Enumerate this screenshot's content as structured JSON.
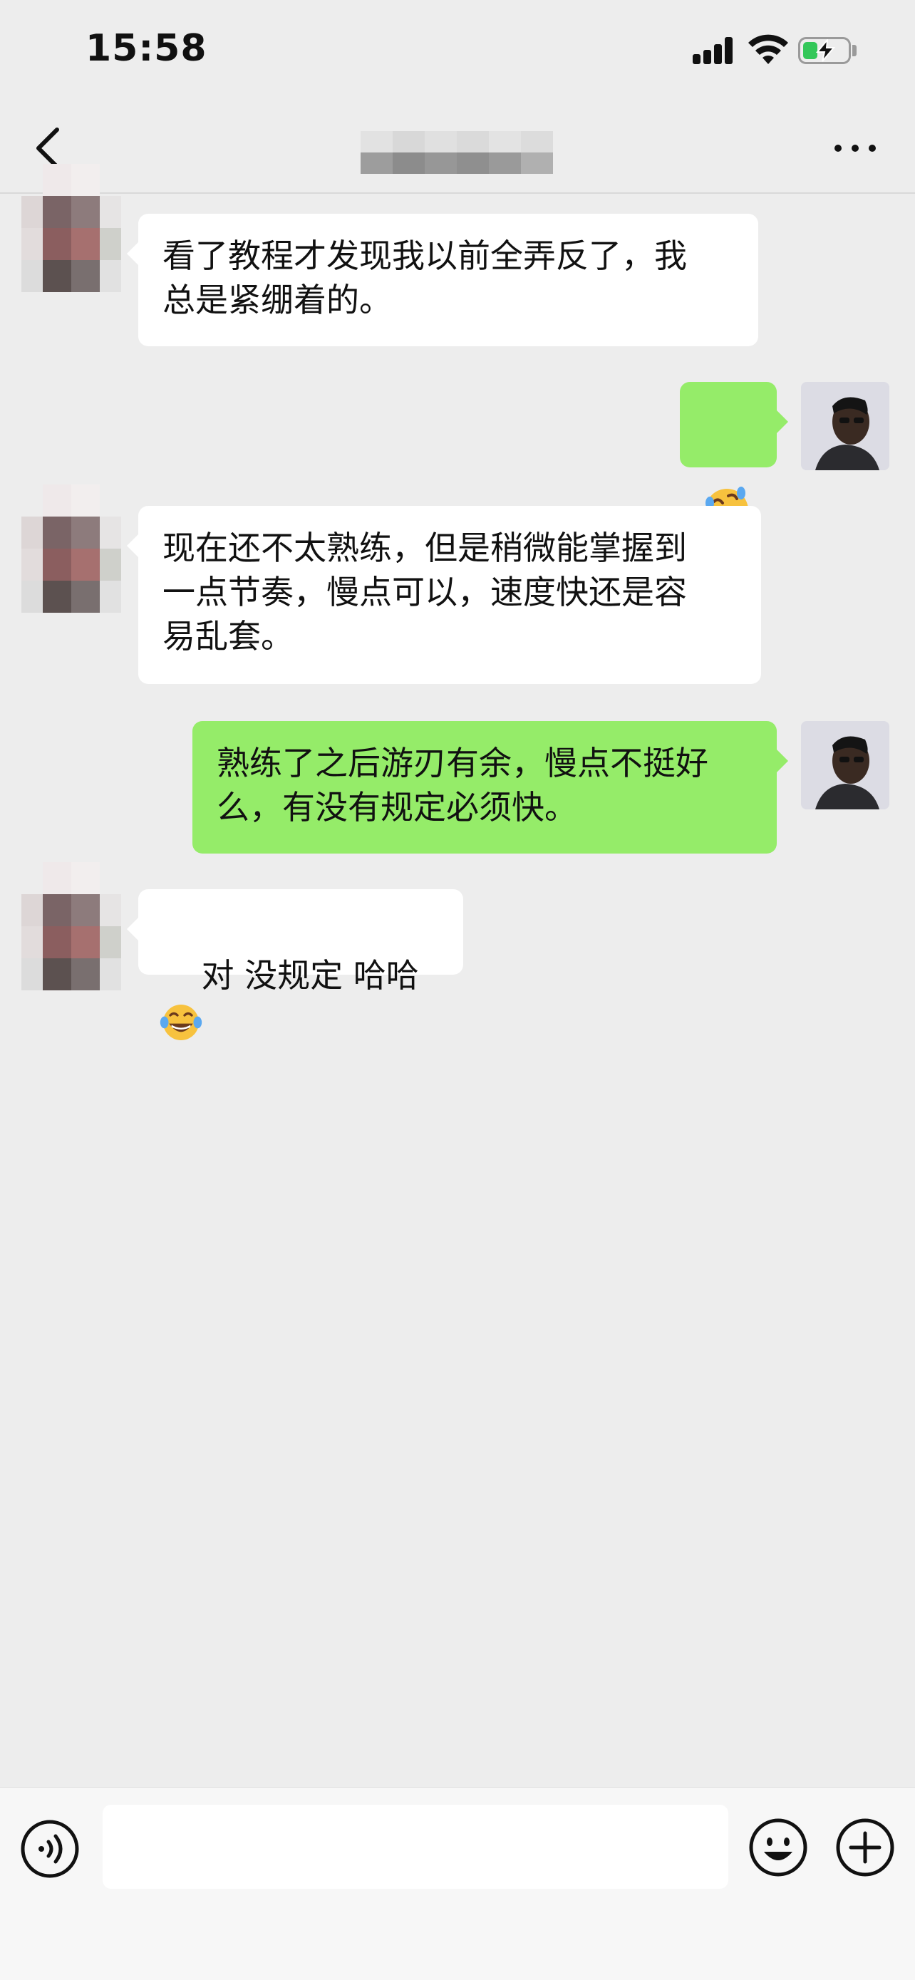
{
  "status_bar": {
    "time": "15:58",
    "battery_color": "#33c759"
  },
  "nav": {
    "back_icon": "chevron-left-icon",
    "more_icon": "ellipsis-icon"
  },
  "messages": [
    {
      "from": "contact",
      "text": "看了教程才发现我以前全弄反了，我\n总是紧绷着的。"
    },
    {
      "from": "me",
      "text": "",
      "emoji": "face-with-tears-of-joy-rolling"
    },
    {
      "from": "contact",
      "text": "现在还不太熟练，但是稍微能掌握到\n一点节奏，慢点可以，速度快还是容\n易乱套。"
    },
    {
      "from": "me",
      "text": "熟练了之后游刃有余，慢点不挺好\n么，有没有规定必须快。"
    },
    {
      "from": "contact",
      "text": "对 没规定 哈哈",
      "emoji": "face-with-tears-of-joy"
    }
  ],
  "input_bar": {
    "voice_icon": "voice-icon",
    "emoji_icon": "smiley-icon",
    "plus_icon": "plus-circle-icon",
    "message_value": "",
    "message_placeholder": ""
  },
  "colors": {
    "background": "#ededed",
    "incoming_bubble": "#ffffff",
    "outgoing_bubble": "#95ec69"
  }
}
